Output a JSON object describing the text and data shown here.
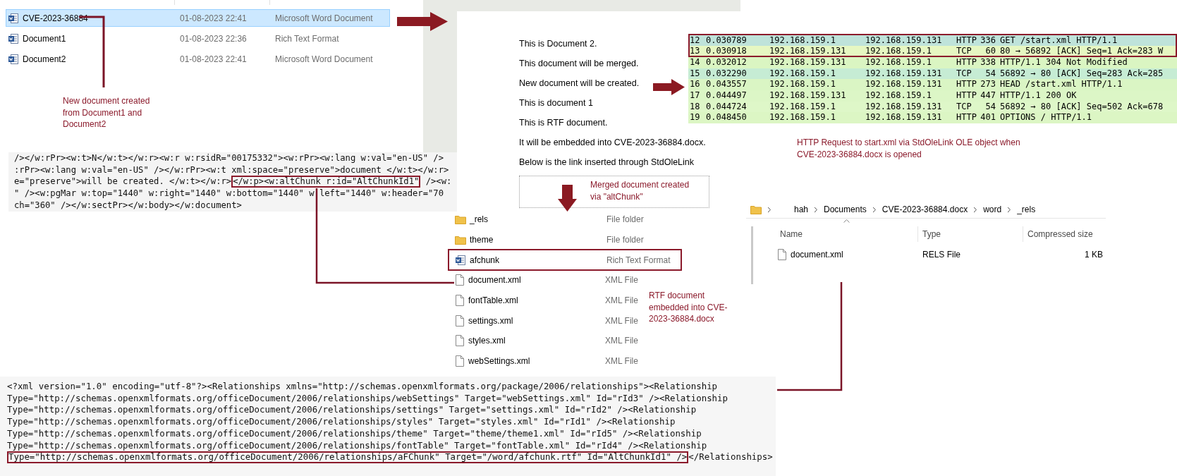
{
  "file_list": {
    "rows": [
      {
        "name": "CVE-2023-36884",
        "date": "01-08-2023 22:41",
        "type": "Microsoft Word Document",
        "selected": true
      },
      {
        "name": "Document1",
        "date": "01-08-2023 22:36",
        "type": "Rich Text Format",
        "selected": false
      },
      {
        "name": "Document2",
        "date": "01-08-2023 22:41",
        "type": "Microsoft Word Document",
        "selected": false
      }
    ]
  },
  "note_new_document": "New document created from Document1 and Document2",
  "document_xml": {
    "lines": [
      [
        {
          "text": "/></w:rPr><w:t>N</w:t></w:r><w:r w:rsidR=\"00175332\"><w:rPr><w:lang w:val=\"en-US\" />",
          "boxed": false
        }
      ],
      [
        {
          "text": ":rPr><w:lang w:val=\"en-US\" /></w:rPr><w:t xml:space=\"preserve\">document </w:t></w:r>",
          "boxed": false
        }
      ],
      [
        {
          "text": "e=\"preserve\">will be created. </w:t></w:r>",
          "boxed": false
        },
        {
          "text": "</w:p><w:altChunk r:id=\"AltChunkId1\"",
          "boxed": true
        },
        {
          "text": " /><w:",
          "boxed": false
        }
      ],
      [
        {
          "text": "\" /><w:pgMar w:top=\"1440\" w:right=\"1440\" w:bottom=\"1440\" w:left=\"1440\" w:header=\"70",
          "boxed": false
        }
      ],
      [
        {
          "text": "ch=\"360\" /></w:sectPr></w:body></w:document>",
          "boxed": false
        }
      ]
    ]
  },
  "word_document": {
    "paragraphs": [
      "This is Document 2.",
      "This document will be merged.",
      "New document will be created.",
      "This is document 1",
      "This is RTF document.",
      "It will be embedded into CVE-2023-36884.docx.",
      "Below is the link inserted through StdOleLink"
    ],
    "note": "Merged document created via \"altChunk\""
  },
  "packet_list": {
    "rows": [
      {
        "no": "12",
        "time": "0.030789",
        "source": "192.168.159.1",
        "destination": "192.168.159.131",
        "protocol": "HTTP",
        "length": "336",
        "info": "GET /start.xml HTTP/1.1",
        "color": "#bfe3da",
        "boxed": true
      },
      {
        "no": "13",
        "time": "0.030918",
        "source": "192.168.159.131",
        "destination": "192.168.159.1",
        "protocol": "TCP",
        "length": "60",
        "info": "80 → 56892 [ACK] Seq=1 Ack=283 W",
        "color": "#e6f7c2",
        "boxed": true
      },
      {
        "no": "14",
        "time": "0.032012",
        "source": "192.168.159.131",
        "destination": "192.168.159.1",
        "protocol": "HTTP",
        "length": "338",
        "info": "HTTP/1.1 304 Not Modified",
        "color": "#daf5c2",
        "boxed": false
      },
      {
        "no": "15",
        "time": "0.032290",
        "source": "192.168.159.1",
        "destination": "192.168.159.131",
        "protocol": "TCP",
        "length": "54",
        "info": "56892 → 80 [ACK] Seq=283 Ack=285",
        "color": "#c6ecd4",
        "boxed": false
      },
      {
        "no": "16",
        "time": "0.043557",
        "source": "192.168.159.1",
        "destination": "192.168.159.131",
        "protocol": "HTTP",
        "length": "273",
        "info": "HEAD /start.xml HTTP/1.1",
        "color": "#daf5c4",
        "boxed": false
      },
      {
        "no": "17",
        "time": "0.044497",
        "source": "192.168.159.131",
        "destination": "192.168.159.1",
        "protocol": "HTTP",
        "length": "447",
        "info": "HTTP/1.1 200 OK",
        "color": "#dcf6c6",
        "boxed": false
      },
      {
        "no": "18",
        "time": "0.044724",
        "source": "192.168.159.1",
        "destination": "192.168.159.131",
        "protocol": "TCP",
        "length": "54",
        "info": "56892 → 80 [ACK] Seq=502 Ack=678",
        "color": "#def7c8",
        "boxed": false
      },
      {
        "no": "19",
        "time": "0.048450",
        "source": "192.168.159.1",
        "destination": "192.168.159.131",
        "protocol": "HTTP",
        "length": "401",
        "info": "OPTIONS / HTTP/1.1",
        "color": "#dcf6c4",
        "boxed": false
      }
    ]
  },
  "note_http": "HTTP Request to start.xml via StdOleLink OLE object when CVE-2023-36884.docx is opened",
  "archive_folder": {
    "breadcrumb": [
      "hah",
      "Documents",
      "CVE-2023-36884.docx",
      "word",
      "_rels"
    ],
    "columns": [
      "Name",
      "Type",
      "Compressed size"
    ],
    "rows": [
      {
        "name": "document.xml",
        "type": "RELS File",
        "compressed_size": "1 KB"
      }
    ]
  },
  "archive_contents": {
    "rows": [
      {
        "kind": "folder",
        "name": "_rels",
        "type": "File folder",
        "boxed": false
      },
      {
        "kind": "folder",
        "name": "theme",
        "type": "File folder",
        "boxed": false
      },
      {
        "kind": "document",
        "name": "afchunk",
        "type": "Rich Text Format",
        "boxed": true
      },
      {
        "kind": "file",
        "name": "document.xml",
        "type": "XML File",
        "boxed": false
      },
      {
        "kind": "file",
        "name": "fontTable.xml",
        "type": "XML File",
        "boxed": false
      },
      {
        "kind": "file",
        "name": "settings.xml",
        "type": "XML File",
        "boxed": false
      },
      {
        "kind": "file",
        "name": "styles.xml",
        "type": "XML File",
        "boxed": false
      },
      {
        "kind": "file",
        "name": "webSettings.xml",
        "type": "XML File",
        "boxed": false
      }
    ]
  },
  "note_rtf": "RTF document embedded into CVE-2023-36884.docx",
  "relationships_xml": {
    "lines": [
      [
        {
          "text": "<?xml version=\"1.0\" encoding=\"utf-8\"?><Relationships xmlns=\"http://schemas.openxmlformats.org/package/2006/relationships\"><Relationship",
          "boxed": false
        }
      ],
      [
        {
          "text": "Type=\"http://schemas.openxmlformats.org/officeDocument/2006/relationships/webSettings\" Target=\"webSettings.xml\" Id=\"rId3\" /><Relationship",
          "boxed": false
        }
      ],
      [
        {
          "text": "Type=\"http://schemas.openxmlformats.org/officeDocument/2006/relationships/settings\" Target=\"settings.xml\" Id=\"rId2\" /><Relationship",
          "boxed": false
        }
      ],
      [
        {
          "text": "Type=\"http://schemas.openxmlformats.org/officeDocument/2006/relationships/styles\" Target=\"styles.xml\" Id=\"rId1\" /><Relationship",
          "boxed": false
        }
      ],
      [
        {
          "text": "Type=\"http://schemas.openxmlformats.org/officeDocument/2006/relationships/theme\" Target=\"theme/theme1.xml\" Id=\"rId5\" /><Relationship",
          "boxed": false
        }
      ],
      [
        {
          "text": "Type=\"http://schemas.openxmlformats.org/officeDocument/2006/relationships/fontTable\" Target=\"fontTable.xml\" Id=\"rId4\" /><Relationship",
          "boxed": false
        }
      ],
      [
        {
          "text": "Type=\"http://schemas.openxmlformats.org/officeDocument/2006/relationships/aFChunk\" Target=\"/word/afchunk.rtf\" Id=\"AltChunkId1\" />",
          "boxed": true
        },
        {
          "text": "</Relationships>",
          "boxed": false
        }
      ]
    ]
  }
}
